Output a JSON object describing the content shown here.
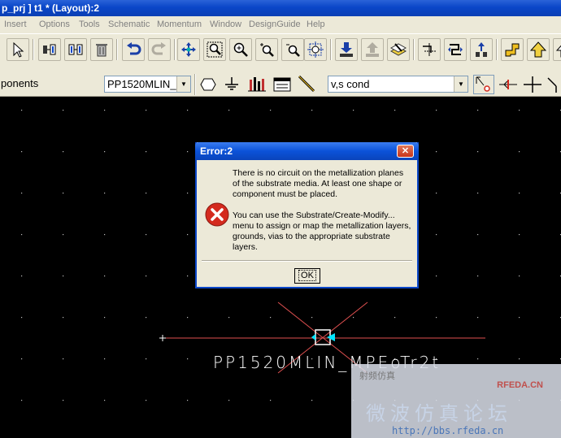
{
  "window": {
    "title": "p_prj ] t1 * (Layout):2"
  },
  "menu": {
    "items": [
      "Insert",
      "Options",
      "Tools",
      "Schematic",
      "Momentum",
      "Window",
      "DesignGuide",
      "Help"
    ]
  },
  "toolbar2": {
    "palette_combo": "ponents",
    "component_combo": "PP1520MLIN_",
    "layer_combo": "v,s cond"
  },
  "dialog": {
    "title": "Error:2",
    "close_label": "✕",
    "paragraph1": "There is no circuit on the metallization planes of the substrate media. At least one shape or component must be placed.",
    "paragraph2": "You can use the Substrate/Create-Modify... menu to assign or map the metallization layers, grounds, vias to the appropriate substrate layers.",
    "ok_label": "OK"
  },
  "canvas": {
    "component_label": "PP1520MLIN_MPEoTr2t"
  },
  "watermark": {
    "brand": "RFEDA.CN",
    "subtitle": "射频仿真",
    "chinese": "微波仿真论坛",
    "url": "http://bbs.rfeda.cn"
  },
  "colors": {
    "title_blue": "#0a46c8",
    "canvas_bg": "#000000",
    "error_red": "#d42a1e",
    "trace_red": "#e05050",
    "port_cyan": "#00e5ff"
  },
  "icons": {
    "toolbar": [
      "pointer-icon",
      "insert-component-icon",
      "insert-component-icon-2",
      "delete-icon",
      "undo-icon",
      "redo-icon",
      "move-icon",
      "zoom-area-icon",
      "zoom-in-icon",
      "zoom-point-icon",
      "zoom-out-icon",
      "zoom-fit-icon",
      "download-icon",
      "upload-icon",
      "stack-icon",
      "snap-icon",
      "route-icon",
      "push-icon",
      "step-icon",
      "up-arrow-icon"
    ]
  }
}
